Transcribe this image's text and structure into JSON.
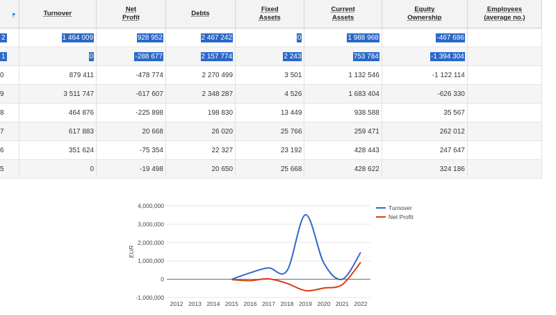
{
  "table": {
    "headers": [
      {
        "key": "year",
        "lines": [
          ""
        ]
      },
      {
        "key": "turnover",
        "lines": [
          "Turnover"
        ]
      },
      {
        "key": "net_profit",
        "lines": [
          "Net",
          "Profit"
        ]
      },
      {
        "key": "debts",
        "lines": [
          "Debts"
        ]
      },
      {
        "key": "fixed_assets",
        "lines": [
          "Fixed",
          "Assets"
        ]
      },
      {
        "key": "current_assets",
        "lines": [
          "Current",
          "Assets"
        ]
      },
      {
        "key": "equity",
        "lines": [
          "Equity",
          "Ownership"
        ]
      },
      {
        "key": "employees",
        "lines": [
          "Employees",
          "(average no.)"
        ]
      }
    ],
    "rows": [
      {
        "year": "2",
        "turnover": "1 464 009",
        "net_profit": "928 952",
        "debts": "2 467 242",
        "fixed_assets": "0",
        "current_assets": "1 988 968",
        "equity": "-467 686",
        "employees": "",
        "selected": true
      },
      {
        "year": "1",
        "turnover": "0",
        "net_profit": "-288 677",
        "debts": "2 157 774",
        "fixed_assets": "2 243",
        "current_assets": "753 784",
        "equity": "-1 394 304",
        "employees": "",
        "selected": true
      },
      {
        "year": "0",
        "turnover": "879 411",
        "net_profit": "-478 774",
        "debts": "2 270 499",
        "fixed_assets": "3 501",
        "current_assets": "1 132 546",
        "equity": "-1 122 114",
        "employees": "",
        "selected": false
      },
      {
        "year": "9",
        "turnover": "3 511 747",
        "net_profit": "-617 607",
        "debts": "2 348 287",
        "fixed_assets": "4 526",
        "current_assets": "1 683 404",
        "equity": "-626 330",
        "employees": "",
        "selected": false
      },
      {
        "year": "8",
        "turnover": "464 876",
        "net_profit": "-225 898",
        "debts": "198 830",
        "fixed_assets": "13 449",
        "current_assets": "938 588",
        "equity": "35 567",
        "employees": "",
        "selected": false
      },
      {
        "year": "7",
        "turnover": "617 883",
        "net_profit": "20 668",
        "debts": "26 020",
        "fixed_assets": "25 766",
        "current_assets": "259 471",
        "equity": "262 012",
        "employees": "",
        "selected": false
      },
      {
        "year": "6",
        "turnover": "351 624",
        "net_profit": "-75 354",
        "debts": "22 327",
        "fixed_assets": "23 192",
        "current_assets": "428 443",
        "equity": "247 647",
        "employees": "",
        "selected": false
      },
      {
        "year": "5",
        "turnover": "0",
        "net_profit": "-19 498",
        "debts": "20 650",
        "fixed_assets": "25 668",
        "current_assets": "428 622",
        "equity": "324 186",
        "employees": "",
        "selected": false
      }
    ]
  },
  "chart_data": {
    "type": "line",
    "title": "",
    "xlabel": "",
    "ylabel": "EUR",
    "x": [
      "2012",
      "2013",
      "2014",
      "2015",
      "2016",
      "2017",
      "2018",
      "2019",
      "2020",
      "2021",
      "2022"
    ],
    "ylim": [
      -1000000,
      4000000
    ],
    "yticks": [
      -1000000,
      0,
      1000000,
      2000000,
      3000000,
      4000000
    ],
    "ytick_labels": [
      "-1,000,000",
      "0",
      "1,000,000",
      "2,000,000",
      "3,000,000",
      "4,000,000"
    ],
    "grid": true,
    "legend": "right",
    "series": [
      {
        "name": "Turnover",
        "color": "#3366cc",
        "x_start_index": 3,
        "values": [
          0,
          351624,
          617883,
          464876,
          3511747,
          879411,
          0,
          1464009
        ]
      },
      {
        "name": "Net Profit",
        "color": "#dc3912",
        "x_start_index": 3,
        "values": [
          -19498,
          -75354,
          20668,
          -225898,
          -617607,
          -478774,
          -288677,
          928952
        ]
      }
    ]
  }
}
